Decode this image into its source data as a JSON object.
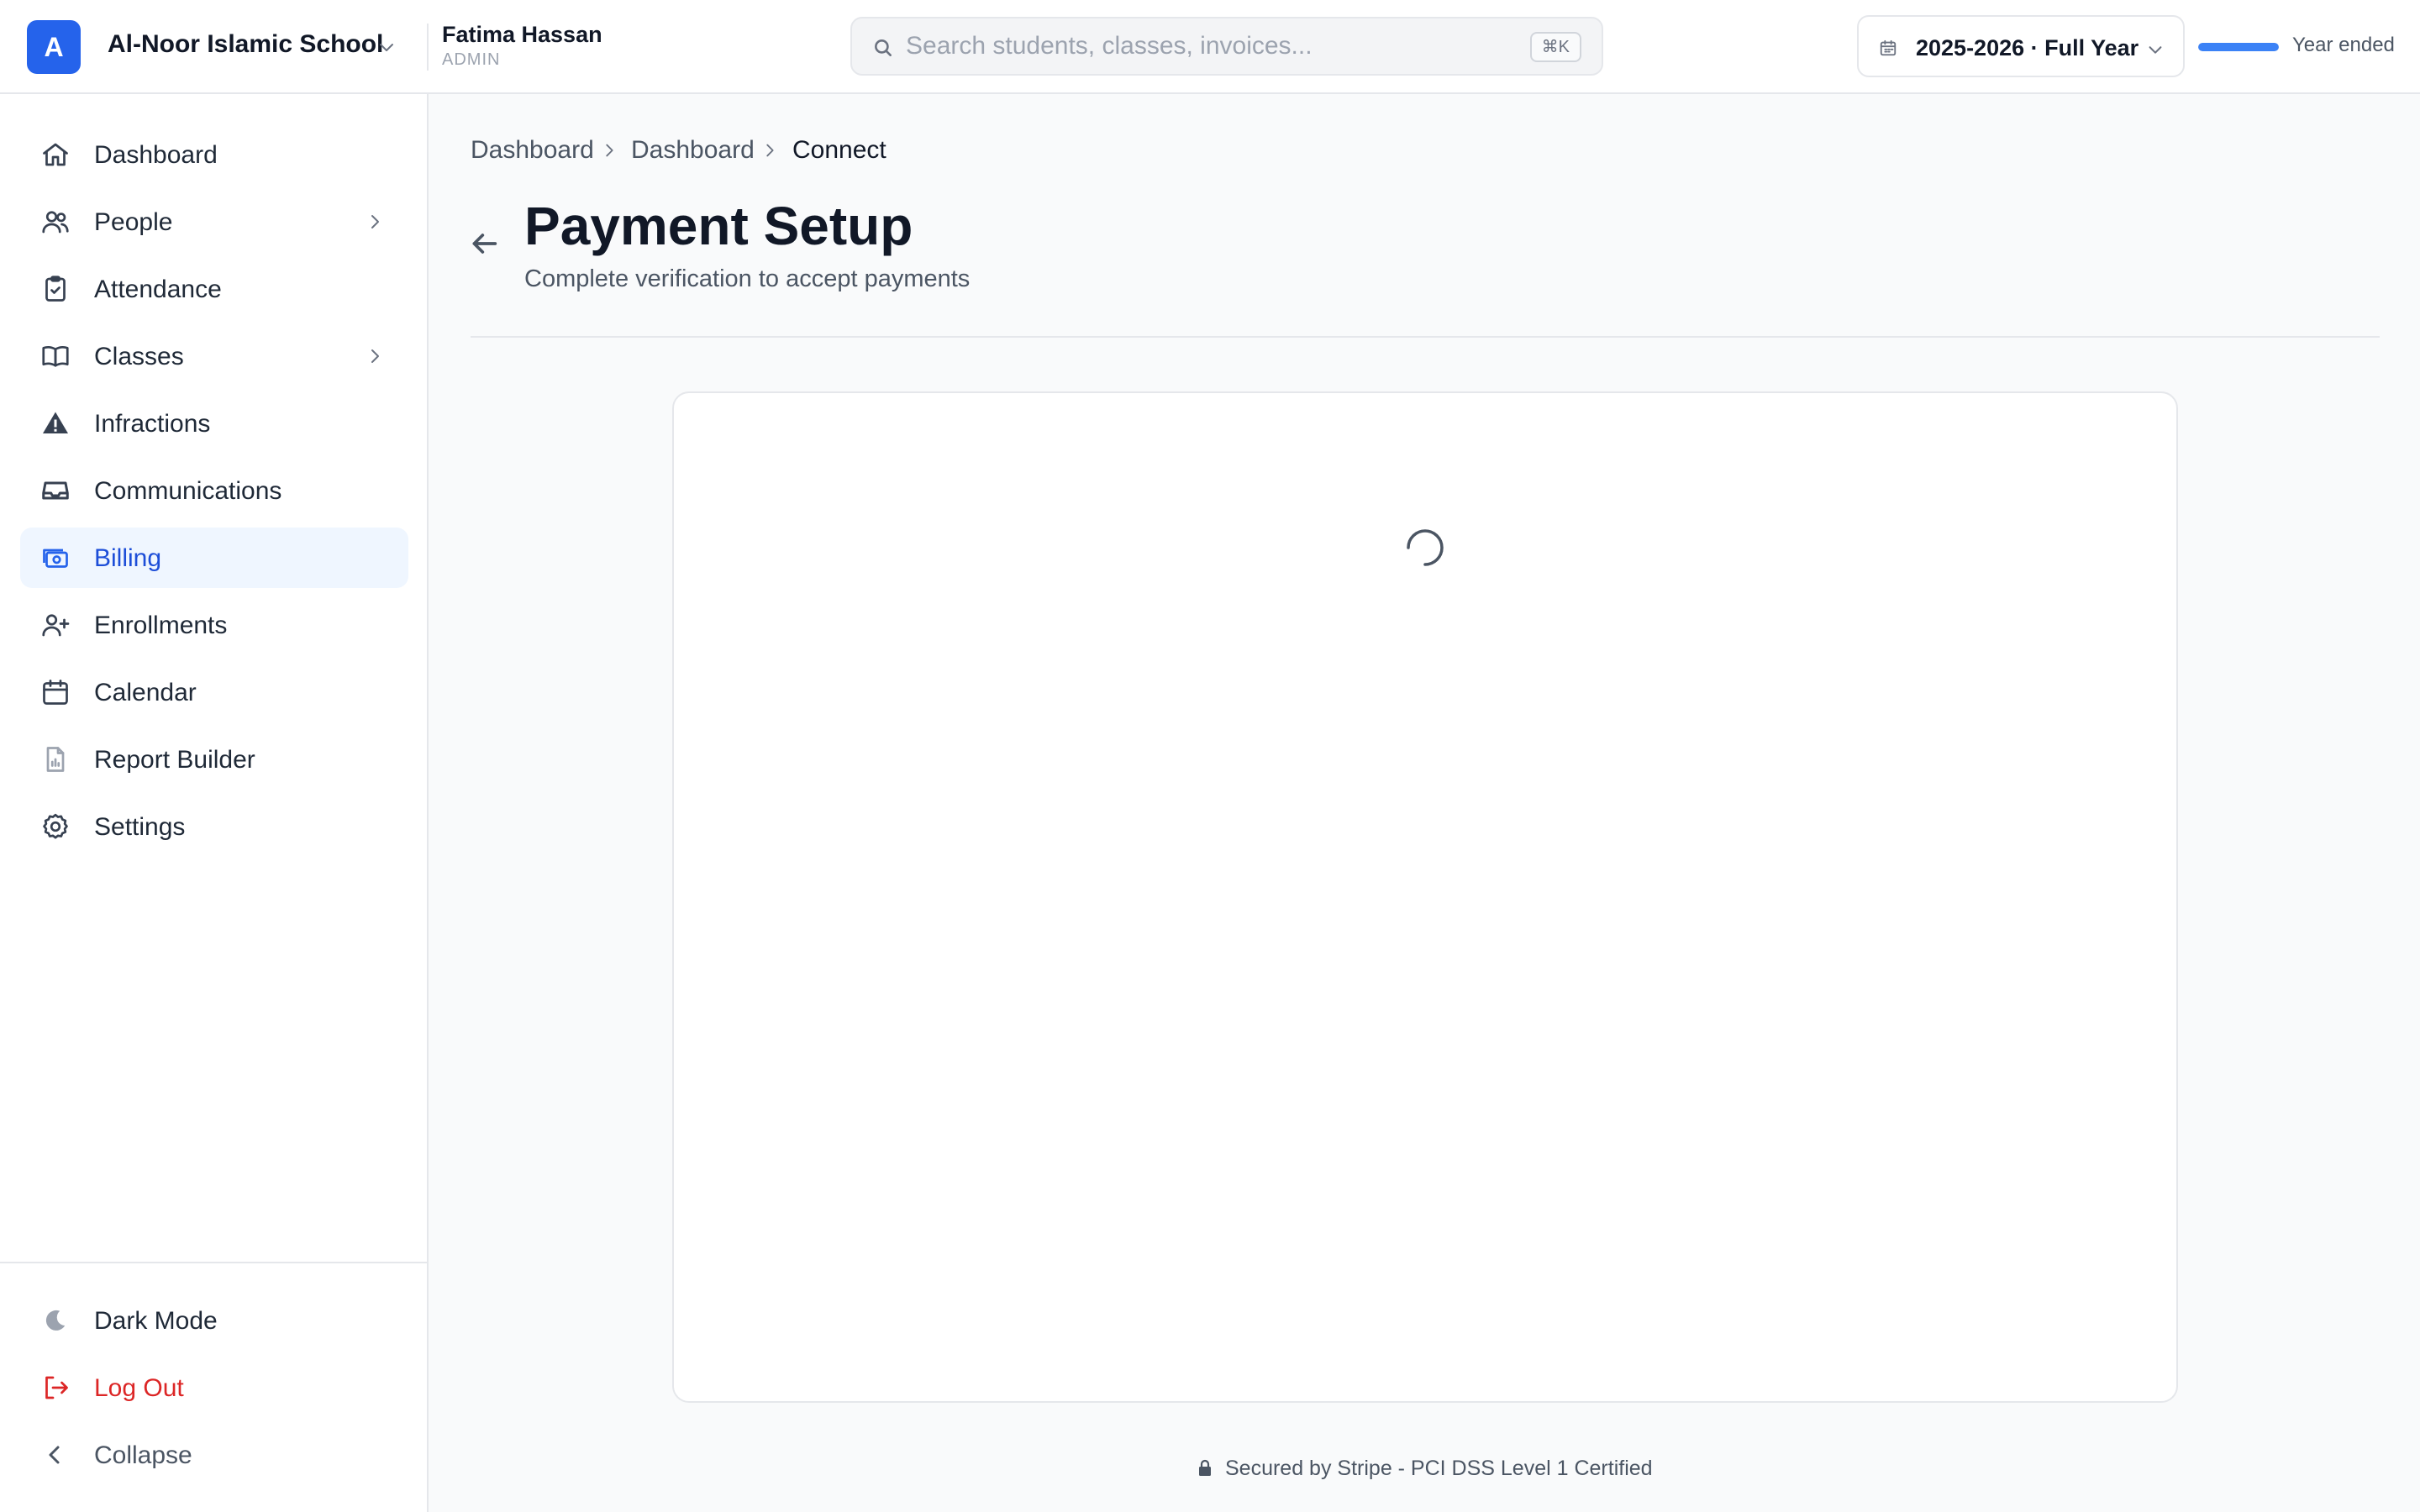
{
  "header": {
    "school_initial": "A",
    "school_name": "Al-Noor Islamic School",
    "user_name": "Fatima Hassan",
    "user_role": "ADMIN",
    "search_placeholder": "Search students, classes, invoices...",
    "search_value": "",
    "search_shortcut": "⌘K",
    "year_label": "2025-2026 · Full Year",
    "year_status": "Year ended",
    "year_progress": 1.0
  },
  "sidebar": {
    "items": [
      {
        "label": "Dashboard",
        "icon": "home-icon"
      },
      {
        "label": "People",
        "icon": "users-icon",
        "has_children": true
      },
      {
        "label": "Attendance",
        "icon": "clipboard-check-icon"
      },
      {
        "label": "Classes",
        "icon": "book-open-icon",
        "has_children": true
      },
      {
        "label": "Infractions",
        "icon": "warning-icon"
      },
      {
        "label": "Communications",
        "icon": "inbox-icon"
      },
      {
        "label": "Billing",
        "icon": "banknotes-icon",
        "active": true
      },
      {
        "label": "Enrollments",
        "icon": "user-plus-icon"
      },
      {
        "label": "Calendar",
        "icon": "calendar-icon"
      },
      {
        "label": "Report Builder",
        "icon": "document-chart-icon"
      },
      {
        "label": "Settings",
        "icon": "gear-icon"
      }
    ],
    "bottom": {
      "dark_mode": "Dark Mode",
      "logout": "Log Out",
      "collapse": "Collapse"
    }
  },
  "breadcrumb": [
    "Dashboard",
    "Dashboard",
    "Connect"
  ],
  "page": {
    "title": "Payment Setup",
    "subtitle": "Complete verification to accept payments"
  },
  "footer": {
    "secure_text": "Secured by Stripe - PCI DSS Level 1 Certified"
  },
  "colors": {
    "accent": "#2563eb",
    "active_bg": "#eff6ff",
    "danger": "#dc2626"
  }
}
